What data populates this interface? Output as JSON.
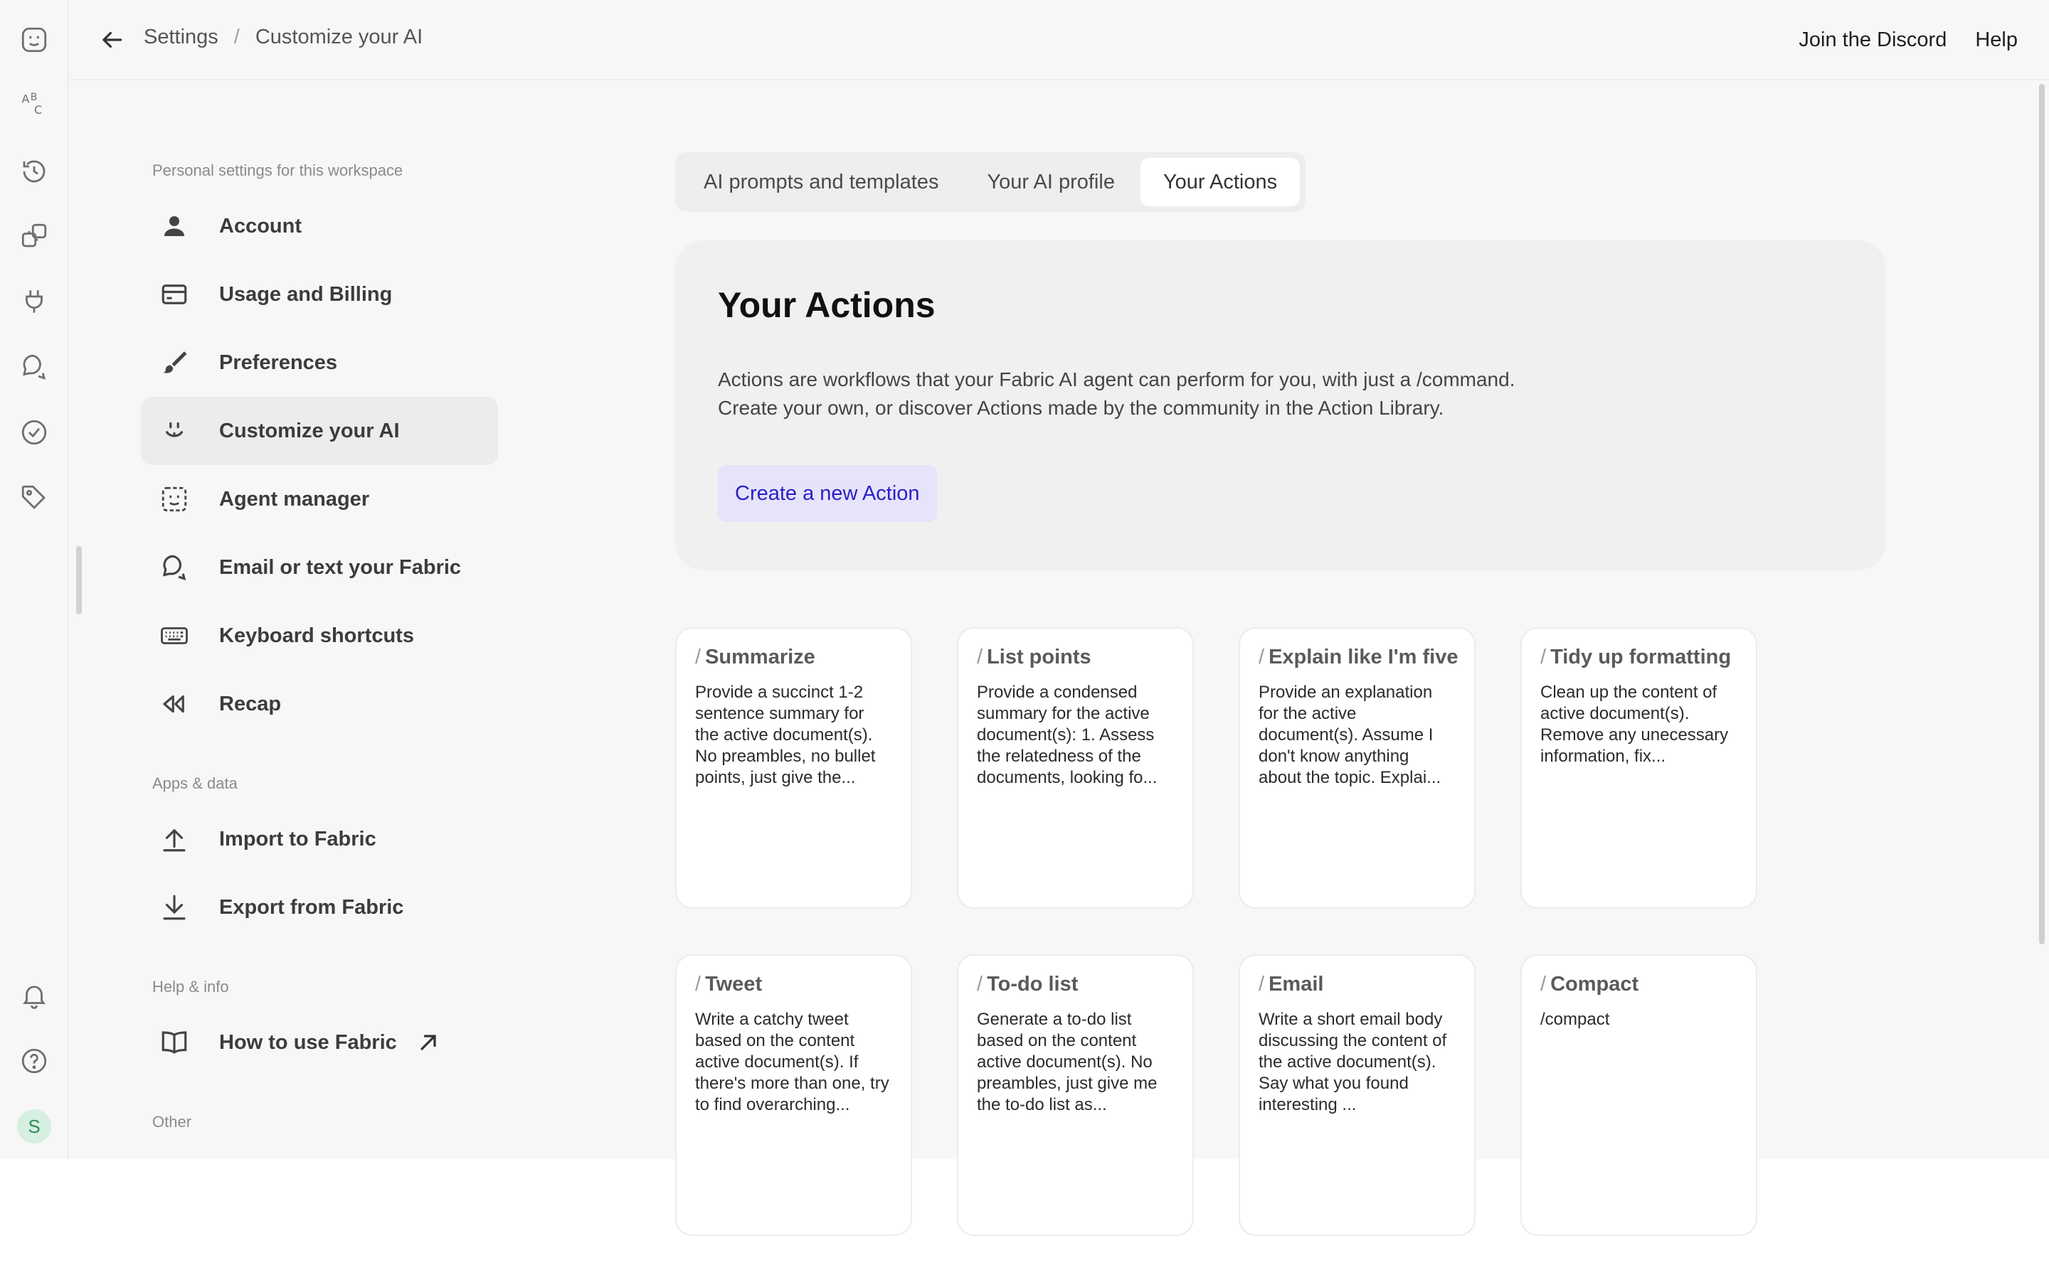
{
  "topbar": {
    "breadcrumb": [
      "Settings",
      "Customize your AI"
    ],
    "breadcrumb_sep": "/",
    "links": [
      "Join the Discord",
      "Help"
    ]
  },
  "rail": {
    "icons": [
      "fabric-face-icon",
      "spellcheck-icon",
      "history-icon",
      "layers-icon",
      "plug-icon",
      "chat-icon",
      "check-circle-icon",
      "tag-icon",
      "bell-icon",
      "help-icon"
    ],
    "avatar": "S"
  },
  "nav": {
    "sections": [
      {
        "title": "Personal settings for this workspace",
        "items": [
          {
            "label": "Account",
            "icon": "person-icon"
          },
          {
            "label": "Usage and Billing",
            "icon": "card-icon"
          },
          {
            "label": "Preferences",
            "icon": "brush-icon"
          },
          {
            "label": "Customize your AI",
            "icon": "smile-icon",
            "active": true
          },
          {
            "label": "Agent manager",
            "icon": "agent-icon"
          },
          {
            "label": "Email or text your Fabric",
            "icon": "chat-icon"
          },
          {
            "label": "Keyboard shortcuts",
            "icon": "keyboard-icon"
          },
          {
            "label": "Recap",
            "icon": "rewind-icon"
          }
        ]
      },
      {
        "title": "Apps & data",
        "items": [
          {
            "label": "Import to Fabric",
            "icon": "upload-icon"
          },
          {
            "label": "Export from Fabric",
            "icon": "download-icon"
          }
        ]
      },
      {
        "title": "Help & info",
        "items": [
          {
            "label": "How to use Fabric",
            "icon": "book-icon",
            "external": true
          }
        ]
      },
      {
        "title": "Other",
        "items": []
      }
    ]
  },
  "tabs": [
    "AI prompts and templates",
    "Your AI profile",
    "Your Actions"
  ],
  "active_tab": "Your Actions",
  "hero": {
    "title": "Your Actions",
    "description_lines": [
      "Actions are workflows that your Fabric AI agent can perform for you, with just a /command.",
      "Create your own, or discover Actions made by the community in the Action Library."
    ],
    "cta": "Create a new Action"
  },
  "actions": [
    {
      "name": "Summarize",
      "description": "Provide a succinct 1-2 sentence summary for the active document(s). No preambles, no bullet points, just give the..."
    },
    {
      "name": "List points",
      "description": "Provide a condensed summary for the active document(s): 1. Assess the relatedness of the documents, looking fo..."
    },
    {
      "name": "Explain like I'm five",
      "description": "Provide an explanation for the active document(s). Assume I don't know anything about the topic. Explai..."
    },
    {
      "name": "Tidy up formatting",
      "description": "Clean up the content of active document(s). Remove any unecessary information, fix..."
    },
    {
      "name": "Tweet",
      "description": "Write a catchy tweet based on the content active document(s). If there's more than one, try to find overarching..."
    },
    {
      "name": "To-do list",
      "description": "Generate a to-do list based on the content active document(s). No preambles, just give me the to-do list as..."
    },
    {
      "name": "Email",
      "description": "Write a short email body discussing the content of the active document(s). Say what you found interesting ..."
    },
    {
      "name": "Compact",
      "description": "/compact"
    }
  ],
  "colors": {
    "background": "#f7f7f7",
    "accent_bg": "#e6e3fb",
    "accent_text": "#2a1fc4",
    "avatar_bg": "#d6efe0",
    "avatar_text": "#2e8a58"
  }
}
